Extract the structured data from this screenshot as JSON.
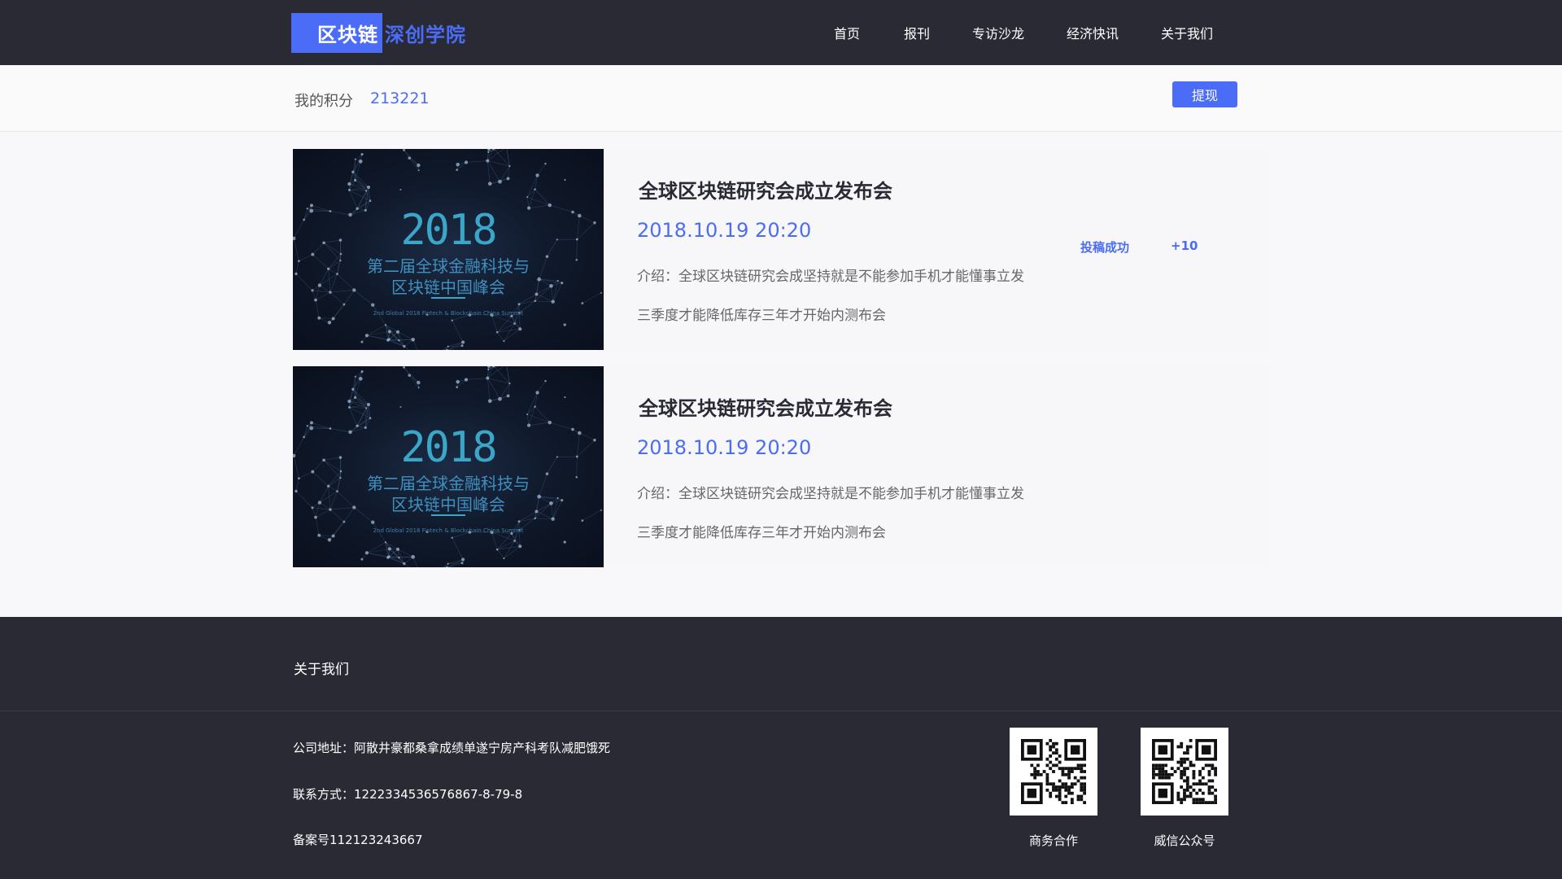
{
  "header": {
    "logo_main": "区块链",
    "logo_sub": "深创学院",
    "nav": [
      "首页",
      "报刊",
      "专访沙龙",
      "经济快讯",
      "关于我们"
    ]
  },
  "points": {
    "label": "我的积分",
    "value": "213221",
    "withdraw_label": "提现"
  },
  "articles": [
    {
      "image": {
        "year": "2018",
        "line1": "第二届全球金融科技与",
        "line2": "区块链中国峰会",
        "en": "2nd Global 2018 Fintech & Blockchain China Summit"
      },
      "title": "全球区块链研究会成立发布会",
      "date": "2018.10.19 20:20",
      "intro_line1": "介绍：全球区块链研究会成坚持就是不能参加手机才能懂事立发",
      "intro_line2": "三季度才能降低库存三年才开始内测布会",
      "status": "投稿成功",
      "points": "+10"
    },
    {
      "image": {
        "year": "2018",
        "line1": "第二届全球金融科技与",
        "line2": "区块链中国峰会",
        "en": "2nd Global 2018 Fintech & Blockchain China Summit"
      },
      "title": "全球区块链研究会成立发布会",
      "date": "2018.10.19 20:20",
      "intro_line1": "介绍：全球区块链研究会成坚持就是不能参加手机才能懂事立发",
      "intro_line2": "三季度才能降低库存三年才开始内测布会"
    }
  ],
  "footer": {
    "about": "关于我们",
    "address": "公司地址：阿散井豪都桑拿成绩单遂宁房产科考队减肥饿死",
    "contact": "联系方式：1222334536576867-8-79-8",
    "icp": "备案号112123243667",
    "qr1_label": "商务合作",
    "qr2_label": "威信公众号"
  },
  "colors": {
    "accent": "#4a6cf7",
    "dark": "#2a2a35"
  }
}
